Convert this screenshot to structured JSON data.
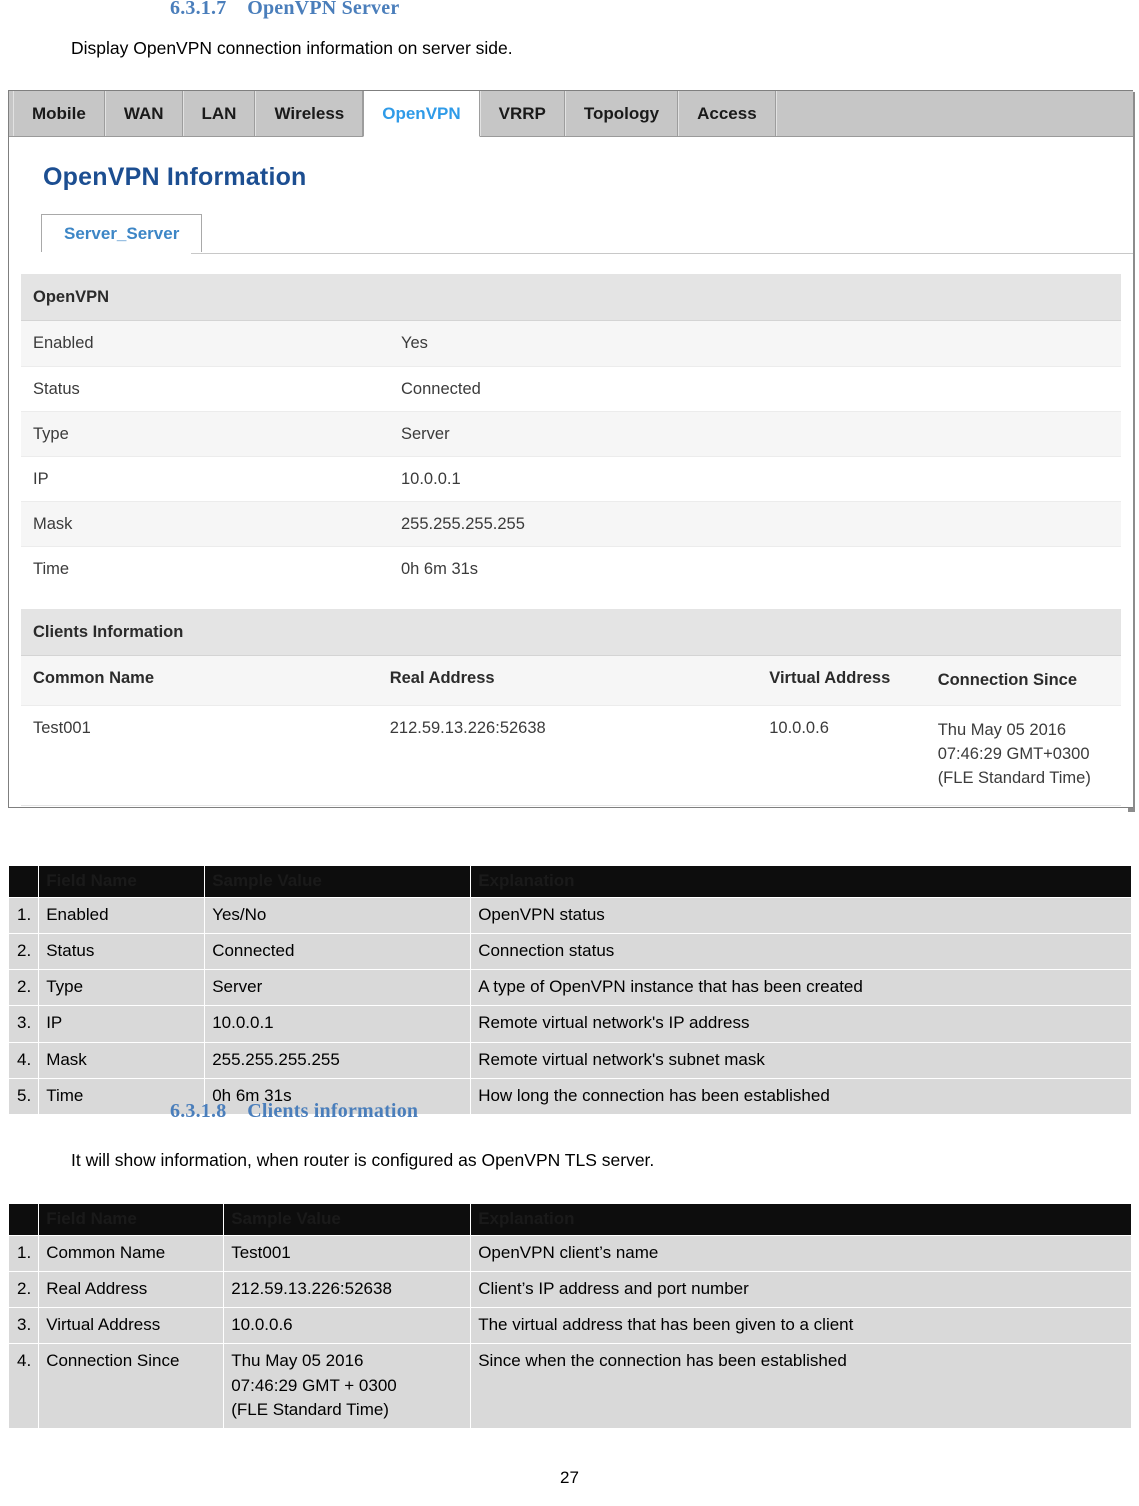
{
  "section_1": {
    "heading": "6.3.1.7    OpenVPN Server",
    "intro": "Display OpenVPN connection information on server side."
  },
  "section_2": {
    "heading": "6.3.1.8    Clients information",
    "intro": "It will show information, when router is configured as OpenVPN TLS server."
  },
  "screenshot": {
    "tabs": [
      {
        "label": "Mobile",
        "active": false
      },
      {
        "label": "WAN",
        "active": false
      },
      {
        "label": "LAN",
        "active": false
      },
      {
        "label": "Wireless",
        "active": false
      },
      {
        "label": "OpenVPN",
        "active": true
      },
      {
        "label": "VRRP",
        "active": false
      },
      {
        "label": "Topology",
        "active": false
      },
      {
        "label": "Access",
        "active": false
      }
    ],
    "panel_title": "OpenVPN Information",
    "subtab": "Server_Server",
    "openvpn_section_label": "OpenVPN",
    "openvpn_rows": [
      {
        "key": "Enabled",
        "value": "Yes"
      },
      {
        "key": "Status",
        "value": "Connected"
      },
      {
        "key": "Type",
        "value": "Server"
      },
      {
        "key": "IP",
        "value": "10.0.0.1"
      },
      {
        "key": "Mask",
        "value": "255.255.255.255"
      },
      {
        "key": "Time",
        "value": "0h 6m 31s"
      }
    ],
    "clients_section_label": "Clients Information",
    "clients_headers": [
      "Common Name",
      "Real Address",
      "Virtual Address",
      "Connection Since"
    ],
    "clients_rows": [
      {
        "common_name": "Test001",
        "real_address": "212.59.13.226:52638",
        "virtual_address": "10.0.0.6",
        "connection_since": "Thu May 05 2016 07:46:29 GMT+0300 (FLE Standard Time)"
      }
    ],
    "accent_color": "#2f9be8",
    "title_color": "#1c4e91"
  },
  "table1": {
    "headers": [
      "",
      "Field Name",
      "Sample Value",
      "Explanation"
    ],
    "rows": [
      {
        "n": "1.",
        "field": "Enabled",
        "sample": "Yes/No",
        "explanation": "OpenVPN status"
      },
      {
        "n": "2.",
        "field": "Status",
        "sample": "Connected",
        "explanation": "Connection status"
      },
      {
        "n": "2.",
        "field": "Type",
        "sample": "Server",
        "explanation": "A type of OpenVPN instance that has been created"
      },
      {
        "n": "3.",
        "field": "IP",
        "sample": "10.0.0.1",
        "explanation": "Remote virtual network's IP address"
      },
      {
        "n": "4.",
        "field": "Mask",
        "sample": "255.255.255.255",
        "explanation": "Remote virtual network's subnet mask"
      },
      {
        "n": "5.",
        "field": "Time",
        "sample": "0h 6m 31s",
        "explanation": "How long the connection has been established"
      }
    ]
  },
  "table2": {
    "headers": [
      "",
      "Field Name",
      "Sample Value",
      "Explanation"
    ],
    "rows": [
      {
        "n": "1.",
        "field": "Common Name",
        "sample": "Test001",
        "explanation": "OpenVPN client’s name"
      },
      {
        "n": "2.",
        "field": "Real Address",
        "sample": "212.59.13.226:52638",
        "explanation": "Client’s IP address and port number"
      },
      {
        "n": "3.",
        "field": "Virtual Address",
        "sample": "10.0.0.6",
        "explanation": "The virtual address that has been given to a client"
      },
      {
        "n": "4.",
        "field": "Connection Since",
        "sample": "Thu May 05 2016\n07:46:29 GMT + 0300\n(FLE Standard Time)",
        "explanation": "Since when the connection has been established"
      }
    ]
  },
  "footer": {
    "page_number": "27"
  }
}
